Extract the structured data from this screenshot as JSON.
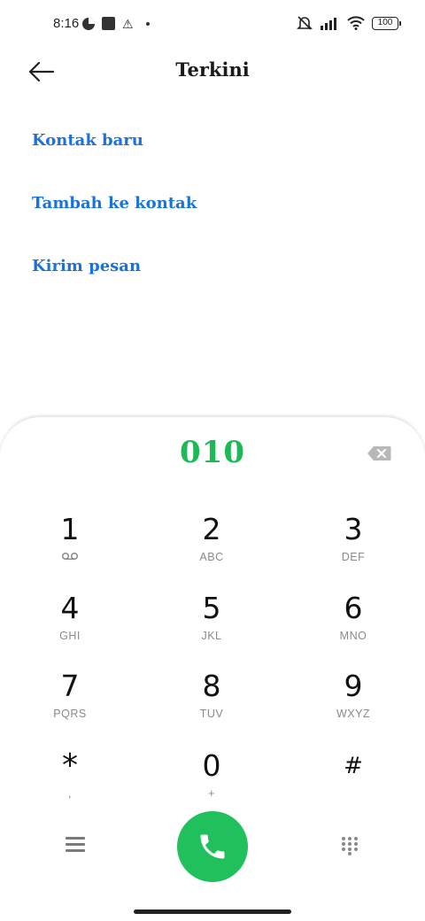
{
  "status_bar": {
    "time": "8:16",
    "battery": "100",
    "icons": [
      "data-saver-icon",
      "square-notification-icon",
      "warning-icon",
      "dot-icon",
      "muted-bell-icon",
      "signal-icon",
      "wifi-icon",
      "battery-icon"
    ]
  },
  "header": {
    "title": "Terkini",
    "back_icon": "arrow-left-icon"
  },
  "actions": {
    "new_contact": "Kontak baru",
    "add_to_contact": "Tambah ke kontak",
    "send_message": "Kirim pesan",
    "color": "#1a73d9"
  },
  "dialer": {
    "number": "010",
    "number_color": "#1db954",
    "keys": [
      {
        "digit": "1",
        "letters": ""
      },
      {
        "digit": "2",
        "letters": "ABC"
      },
      {
        "digit": "3",
        "letters": "DEF"
      },
      {
        "digit": "4",
        "letters": "GHI"
      },
      {
        "digit": "5",
        "letters": "JKL"
      },
      {
        "digit": "6",
        "letters": "MNO"
      },
      {
        "digit": "7",
        "letters": "PQRS"
      },
      {
        "digit": "8",
        "letters": "TUV"
      },
      {
        "digit": "9",
        "letters": "WXYZ"
      },
      {
        "digit": "*",
        "letters": ","
      },
      {
        "digit": "0",
        "letters": "+"
      },
      {
        "digit": "#",
        "letters": ""
      }
    ],
    "call_color": "#20c05c"
  }
}
